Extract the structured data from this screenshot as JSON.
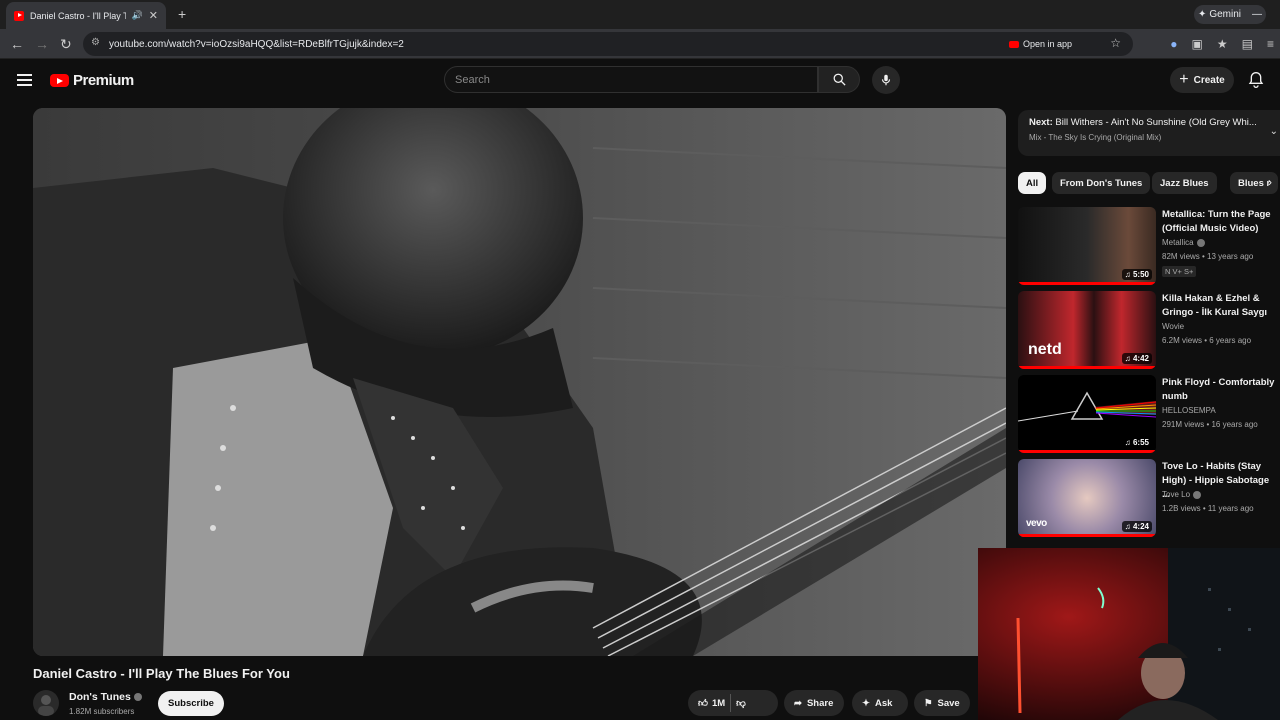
{
  "browser": {
    "tab_title": "Daniel Castro - I'll Play The",
    "url": "youtube.com/watch?v=ioOzsi9aHQQ&list=RDeBlfrTGjujk&index=2",
    "open_in_app": "Open in app",
    "gemini": "Gemini"
  },
  "header": {
    "logo_text": "Premium",
    "search_placeholder": "Search",
    "create_label": "Create"
  },
  "video": {
    "title": "Daniel Castro - I'll Play The Blues For You",
    "channel": "Don's Tunes",
    "subscribers": "1.82M subscribers",
    "subscribe_label": "Subscribe",
    "likes": "1M",
    "share_label": "Share",
    "ask_label": "Ask",
    "save_label": "Save"
  },
  "up_next": {
    "prefix": "Next:",
    "title": "Bill Withers - Ain't No Sunshine (Old Grey Whi...",
    "mix": "Mix - The Sky Is Crying (Original Mix)"
  },
  "chips": [
    "All",
    "From Don's Tunes",
    "Jazz Blues",
    "Blues r"
  ],
  "recommendations": [
    {
      "title": "Metallica: Turn the Page (Official Music Video)",
      "channel": "Metallica",
      "verified": true,
      "meta": "82M views • 13 years ago",
      "badge": "N V+ S+",
      "duration": "5:50",
      "thumb_colors": [
        "#1b1b1b",
        "#6b4a3a"
      ]
    },
    {
      "title": "Killa Hakan & Ezhel & Gringo - İlk Kural Saygı",
      "channel": "Wovie",
      "verified": false,
      "meta": "6.2M views • 6 years ago",
      "badge": "",
      "duration": "4:42",
      "thumb_colors": [
        "#2b1012",
        "#c0272d"
      ]
    },
    {
      "title": "Pink Floyd - Comfortably numb",
      "channel": "HELLOSEMPA",
      "verified": false,
      "meta": "291M views • 16 years ago",
      "badge": "",
      "duration": "6:55",
      "thumb_colors": [
        "#000000",
        "#111111"
      ]
    },
    {
      "title": "Tove Lo - Habits (Stay High) - Hippie Sabotage ...",
      "channel": "Tove Lo",
      "verified": true,
      "meta": "1.2B views • 11 years ago",
      "badge": "",
      "duration": "4:24",
      "thumb_colors": [
        "#7a7a9a",
        "#c9a6b8"
      ]
    }
  ],
  "colors": {
    "brand": "#ff0000",
    "bg": "#0f0f0f"
  }
}
